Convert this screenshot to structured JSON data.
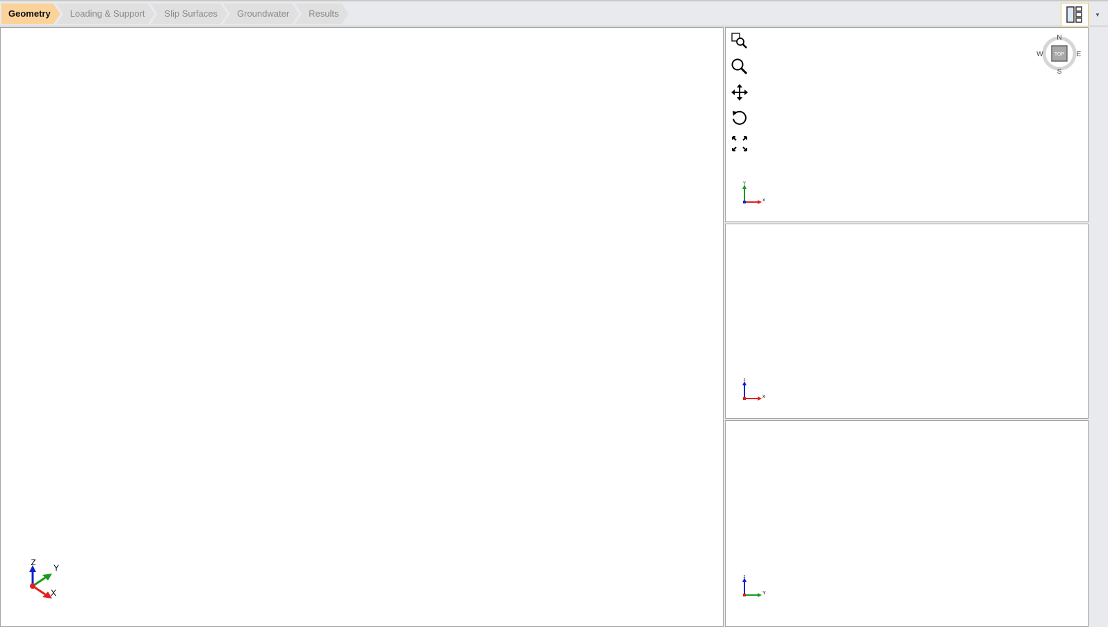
{
  "workflow_tabs": [
    {
      "label": "Geometry",
      "active": true
    },
    {
      "label": "Loading & Support",
      "active": false
    },
    {
      "label": "Slip Surfaces",
      "active": false
    },
    {
      "label": "Groundwater",
      "active": false
    },
    {
      "label": "Results",
      "active": false
    }
  ],
  "toolbar": {
    "layout_icon": "viewport-layout-icon",
    "dropdown_icon": "chevron-down-icon"
  },
  "view_tools": [
    "zoom-window-icon",
    "zoom-icon",
    "pan-icon",
    "rotate-icon",
    "zoom-extents-icon"
  ],
  "compass": {
    "n": "N",
    "s": "S",
    "e": "E",
    "w": "W",
    "center": "TOP"
  },
  "main_axes": {
    "x": "X",
    "y": "Y",
    "z": "Z"
  },
  "top_axes": {
    "h": "x",
    "v": "Y"
  },
  "front_axes": {
    "h": "x",
    "v": "z"
  },
  "side_axes": {
    "h": "Y",
    "v": "z"
  },
  "colors": {
    "active_tab": "#fcd29b",
    "x_axis": "#e02020",
    "y_axis": "#1a9a1a",
    "z_axis": "#1020d0"
  }
}
